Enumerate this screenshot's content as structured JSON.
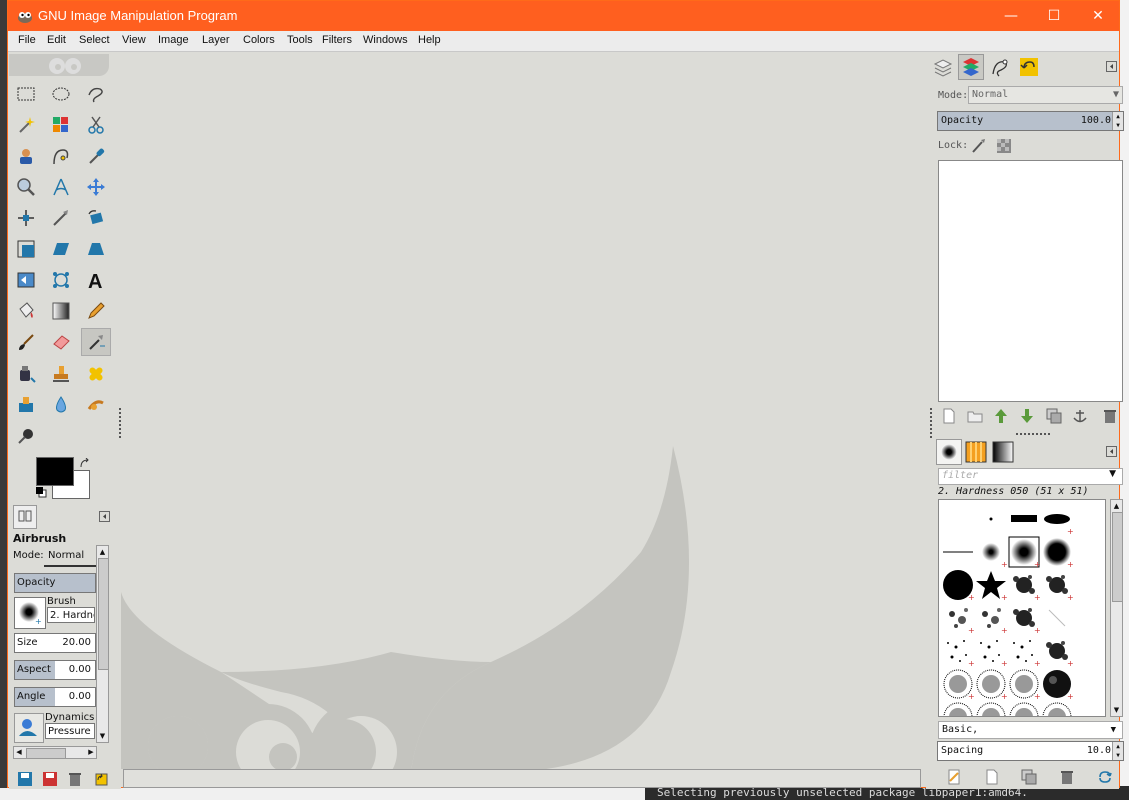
{
  "window": {
    "title": "GNU Image Manipulation Program",
    "minimize": "—",
    "maximize": "☐",
    "close": "✕"
  },
  "menu": [
    "File",
    "Edit",
    "Select",
    "View",
    "Image",
    "Layer",
    "Colors",
    "Tools",
    "Filters",
    "Windows",
    "Help"
  ],
  "tool_options": {
    "title": "Airbrush",
    "mode_label": "Mode:",
    "mode_value": "Normal",
    "opacity_label": "Opacity",
    "brush_label": "Brush",
    "brush_value": "2. Hardne",
    "size_label": "Size",
    "size_value": "20.00",
    "aspect_label": "Aspect ..",
    "aspect_value": "0.00",
    "angle_label": "Angle",
    "angle_value": "0.00",
    "dynamics_label": "Dynamics",
    "dynamics_value": "Pressure"
  },
  "layers": {
    "mode_label": "Mode:",
    "mode_value": "Normal",
    "opacity_label": "Opacity",
    "opacity_value": "100.0",
    "lock_label": "Lock:"
  },
  "brushes": {
    "filter_placeholder": "filter",
    "selected_brush": "2. Hardness 050 (51 x 51)",
    "preset": "Basic,",
    "spacing_label": "Spacing",
    "spacing_value": "10.0"
  },
  "terminal_bottom": "Selecting previously unselected package libpaper1:amd64."
}
